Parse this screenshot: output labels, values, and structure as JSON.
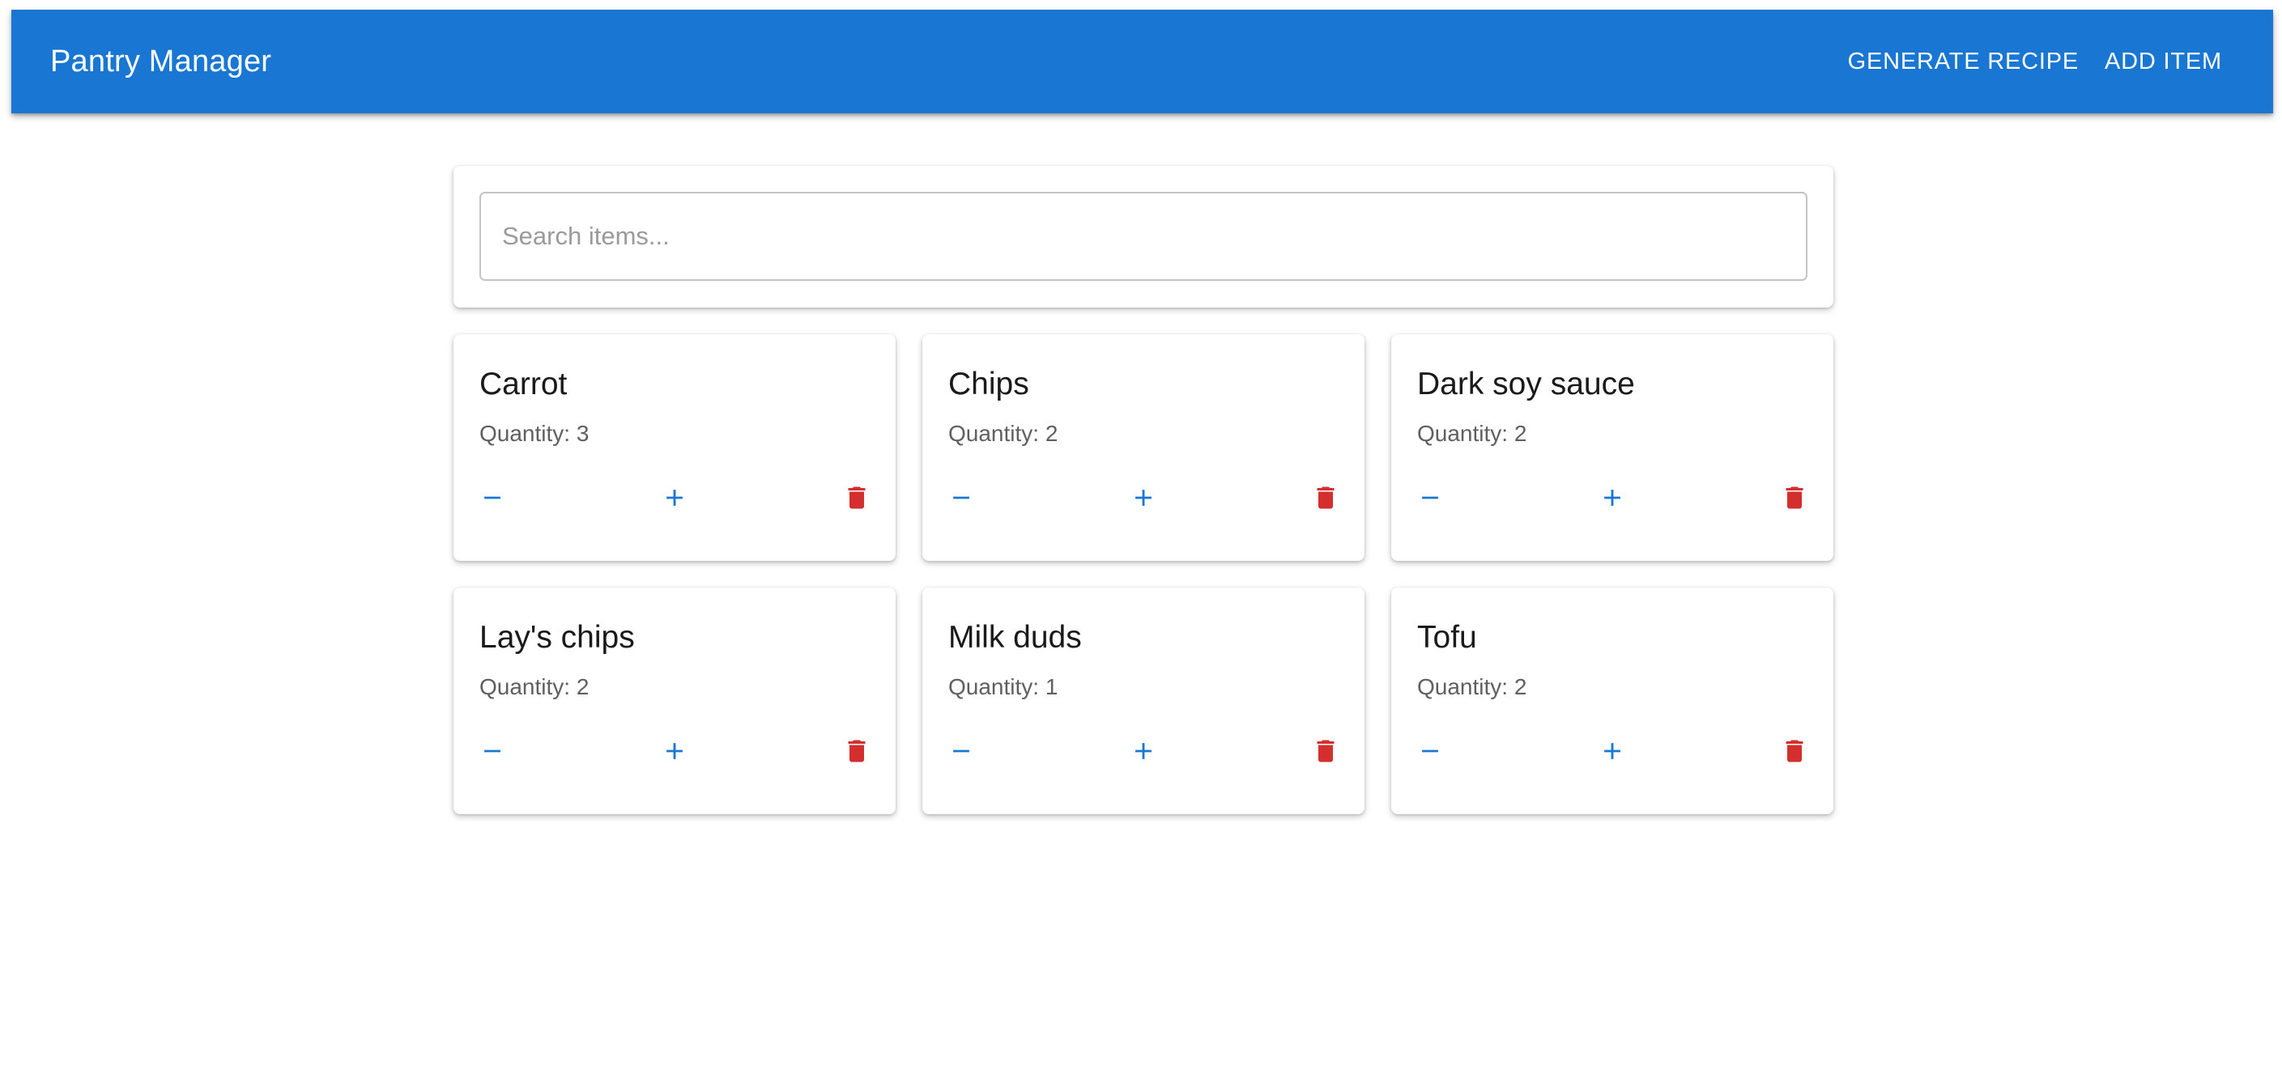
{
  "header": {
    "title": "Pantry Manager",
    "actions": {
      "generate_recipe": "GENERATE RECIPE",
      "add_item": "ADD ITEM"
    }
  },
  "search": {
    "placeholder": "Search items...",
    "value": ""
  },
  "items": [
    {
      "name": "Carrot",
      "quantity_label": "Quantity:",
      "quantity": "3"
    },
    {
      "name": "Chips",
      "quantity_label": "Quantity:",
      "quantity": "2"
    },
    {
      "name": "Dark soy sauce",
      "quantity_label": "Quantity:",
      "quantity": "2"
    },
    {
      "name": "Lay's chips",
      "quantity_label": "Quantity:",
      "quantity": "2"
    },
    {
      "name": "Milk duds",
      "quantity_label": "Quantity:",
      "quantity": "1"
    },
    {
      "name": "Tofu",
      "quantity_label": "Quantity:",
      "quantity": "2"
    }
  ],
  "icons": {
    "decrement": "minus-icon",
    "increment": "plus-icon",
    "delete": "trash-icon"
  },
  "colors": {
    "primary": "#1976d2",
    "danger": "#d32f2f",
    "background": "#ffffff"
  }
}
